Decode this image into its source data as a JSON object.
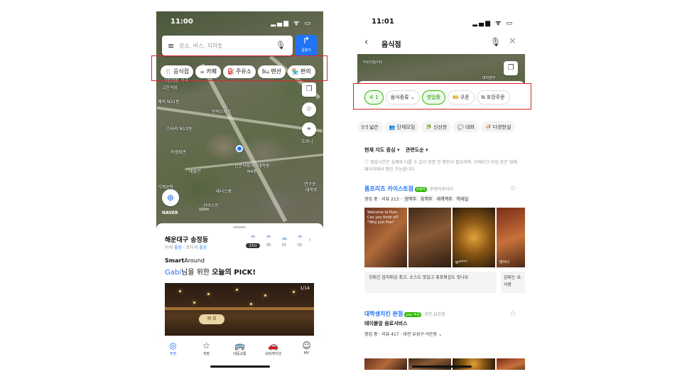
{
  "left_phone": {
    "status": {
      "time": "11:00",
      "icons": "▂▄▆ ᯤ ▭"
    },
    "search": {
      "menu_icon": "menu-icon",
      "placeholder": "장소, 버스, 지하철, 주소 검색",
      "directions_label": "길찾기"
    },
    "categories": [
      {
        "icon": "🍴",
        "label": "음식점"
      },
      {
        "icon": "☕",
        "label": "카페"
      },
      {
        "icon": "⛽",
        "label": "주유소"
      },
      {
        "icon": "🛏",
        "label": "펜션"
      },
      {
        "icon": "🏪",
        "label": "편의"
      }
    ],
    "map_labels": [
      "시민정원 서구",
      "고운식당",
      "패러 N31동",
      "진덕스마트",
      "스터리 N13동",
      "학생회관",
      "태물관",
      "인문사회과학대학동",
      "N4동",
      "기계공학",
      "카이스트",
      "흐로나",
      "연구로",
      "대학로",
      "테니스장"
    ],
    "map_attribution": {
      "brand": "NAVER",
      "scale": "100m"
    },
    "sheet": {
      "location": "해운대구 송정동",
      "dust_prefix": "미세",
      "dust_value": "좋음",
      "ultra_prefix": "· 초미세",
      "ultra_value": "좋음",
      "weather": [
        {
          "hour": "23시",
          "current": true
        },
        {
          "hour": "00",
          "current": false
        },
        {
          "hour": "01",
          "current": false
        },
        {
          "hour": "02",
          "current": false
        }
      ],
      "smart_prefix": "Smart",
      "smart_suffix": "Around",
      "pick_name": "Gabi",
      "pick_mid": "님을 위한 ",
      "pick_bold": "오늘의 PICK!",
      "photo_counter": "1/14",
      "photo_sign": "해 희"
    },
    "tabs": [
      {
        "icon": "◎",
        "label": "주변",
        "active": true
      },
      {
        "icon": "☆",
        "label": "저장",
        "active": false
      },
      {
        "icon": "🚌",
        "label": "대중교통",
        "active": false
      },
      {
        "icon": "🚗",
        "label": "내비게이션",
        "active": false
      },
      {
        "icon": "☺",
        "label": "MY",
        "active": false
      }
    ]
  },
  "right_phone": {
    "status": {
      "time": "11:01",
      "icons": "▂▄▆ ᯤ ▭"
    },
    "nav": {
      "back": "‹",
      "title": "음식점",
      "mic": "🎙",
      "close": "✕"
    },
    "map_labels": [
      "어린이놀이터",
      "대학본부"
    ],
    "filters": [
      {
        "icon": "⚟",
        "label": "1",
        "on": true
      },
      {
        "icon": "",
        "label": "음식종류 ⌄",
        "on": false
      },
      {
        "icon": "",
        "label": "영업중",
        "on": true
      },
      {
        "icon": "🎫",
        "label": "쿠폰",
        "on": false
      },
      {
        "icon": "N",
        "label": "포장주문",
        "on": false
      }
    ],
    "tags": [
      {
        "icon": "🍽",
        "label": "넓은"
      },
      {
        "icon": "👥",
        "label": "단체모임"
      },
      {
        "icon": "🥬",
        "label": "신선한"
      },
      {
        "icon": "💬",
        "label": "대화"
      },
      {
        "icon": "🍜",
        "label": "다양한실"
      }
    ],
    "sort": {
      "area": "현재 지도 중심 ▾",
      "order": "관련도순 ▾"
    },
    "notice": "ⓘ 영업시간은 실제와 다를 수 있어 방문 전 확인이 필요하며, 브레이크 타임 등은 업체 페이지에서 확인 가능합니다.",
    "results": [
      {
        "name": "폼프리츠 카이스트점",
        "badge": "N예약",
        "category": "후렌치후라이",
        "meta": "영업 중 · 리뷰 213 ·",
        "keywords": [
          "생맥주",
          "흑맥주",
          "세계맥주",
          "칵테일"
        ],
        "photo_caption": "Welcome to Pom. Can you think of? \"Why Just Fren\"",
        "photo_user": "gri****",
        "photo_user2": "엔지너",
        "review": "깃튀긴 감자튀김 최고. 소스도 맛있고 퓨포튀김도 맛나요",
        "review2": "감튀는 요. 사장"
      },
      {
        "name": "대학생치킨 본점",
        "badge": "pay·주문",
        "category": "치킨,닭강정",
        "sub": "테이블앞 음료서비스",
        "meta": "영업 중 · 리뷰 417 · 대전 유성구 어은동 ⌄"
      }
    ]
  }
}
